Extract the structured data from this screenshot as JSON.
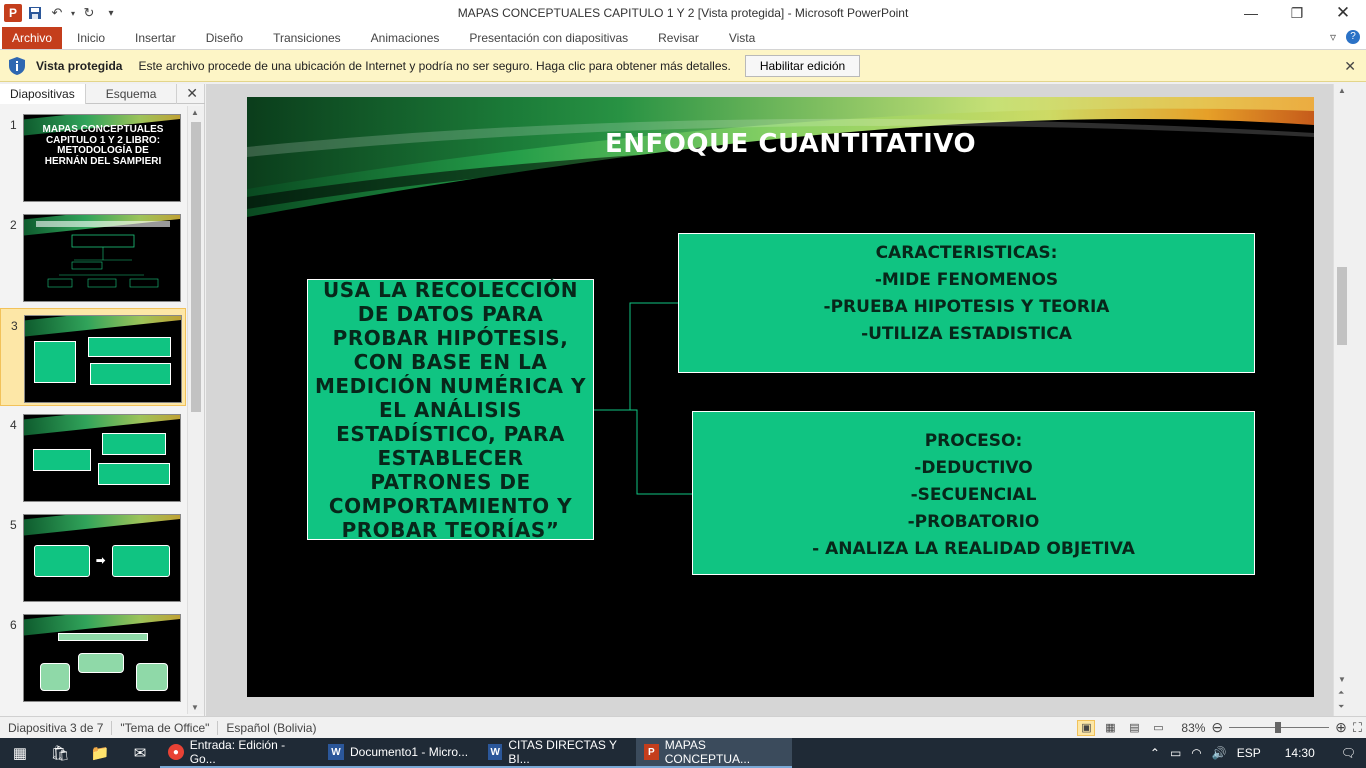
{
  "window": {
    "title": "MAPAS CONCEPTUALES CAPITULO 1 Y 2 [Vista protegida]  -  Microsoft PowerPoint",
    "app_icon": "P"
  },
  "ribbon": {
    "tabs": [
      "Archivo",
      "Inicio",
      "Insertar",
      "Diseño",
      "Transiciones",
      "Animaciones",
      "Presentación con diapositivas",
      "Revisar",
      "Vista"
    ]
  },
  "protected_view": {
    "title": "Vista protegida",
    "message": "Este archivo procede de una ubicación de Internet y podría no ser seguro. Haga clic para obtener más detalles.",
    "button": "Habilitar edición"
  },
  "pane": {
    "tab_slides": "Diapositivas",
    "tab_outline": "Esquema",
    "thumbnails": [
      {
        "num": "1",
        "title": "MAPAS CONCEPTUALES CAPITULO 1 Y 2 LIBRO: METODOLOGÍA DE HERNÁN DEL SAMPIERI"
      },
      {
        "num": "2"
      },
      {
        "num": "3"
      },
      {
        "num": "4"
      },
      {
        "num": "5"
      },
      {
        "num": "6"
      }
    ]
  },
  "slide": {
    "title": "ENFOQUE CUANTITATIVO",
    "main_text": "USA LA RECOLECCIÓN  DE DATOS  PARA PROBAR HIPÓTESIS,  CON BASE EN LA MEDICIÓN  NUMÉRICA Y EL ANÁLISIS ESTADÍSTICO,  PARA ESTABLECER  PATRONES  DE COMPORTAMIENTO  Y PROBAR TEORÍAS”",
    "box_a": [
      "CARACTERISTICAS:",
      "-MIDE FENOMENOS",
      "-PRUEBA HIPOTESIS Y TEORIA",
      "-UTILIZA ESTADISTICA"
    ],
    "box_b": [
      "PROCESO:",
      "-DEDUCTIVO",
      "-SECUENCIAL",
      "-PROBATORIO",
      "- ANALIZA LA REALIDAD OBJETIVA"
    ]
  },
  "status": {
    "slide_info": "Diapositiva 3 de 7",
    "theme": "\"Tema de Office\"",
    "language": "Español (Bolivia)",
    "zoom": "83%"
  },
  "taskbar": {
    "apps": [
      {
        "label": "Entrada: Edición - Go..."
      },
      {
        "label": "Documento1 - Micro..."
      },
      {
        "label": "CITAS DIRECTAS Y BI..."
      },
      {
        "label": "MAPAS CONCEPTUA..."
      }
    ],
    "lang": "ESP",
    "time": "14:30"
  },
  "colors": {
    "accent_file_tab": "#c43e1c",
    "box_green": "#10c482",
    "protected_bar": "#fdf5c6"
  }
}
